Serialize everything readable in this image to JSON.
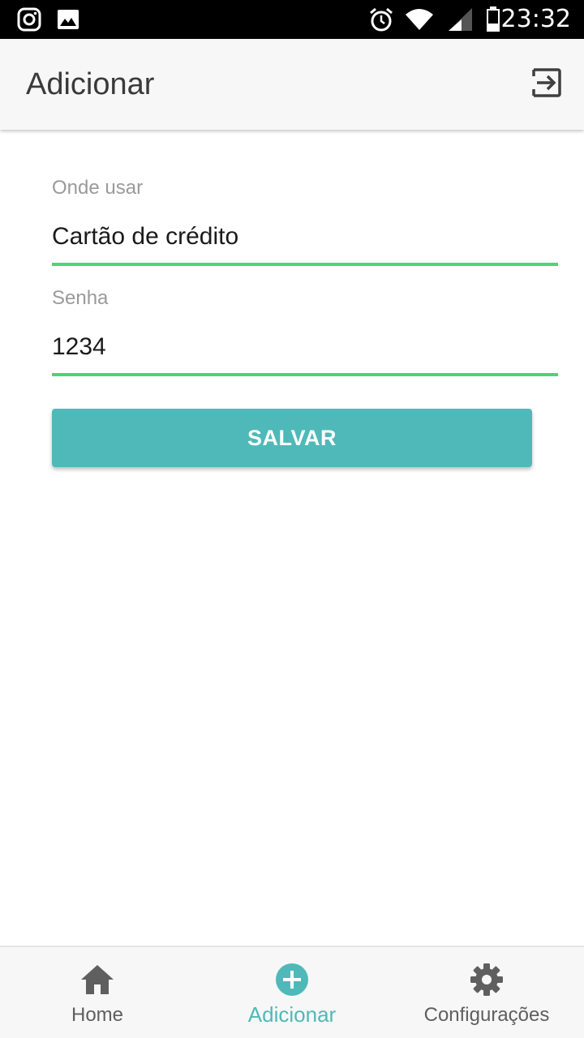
{
  "status_bar": {
    "left_icons": [
      "instagram-icon",
      "image-icon"
    ],
    "right_icons": [
      "alarm-icon",
      "wifi-icon",
      "signal-icon",
      "battery-icon"
    ],
    "time": "23:32"
  },
  "app_bar": {
    "title": "Adicionar",
    "action_icon": "logout-icon"
  },
  "form": {
    "onde_usar": {
      "label": "Onde usar",
      "value": "Cartão de crédito"
    },
    "senha": {
      "label": "Senha",
      "value": "1234"
    },
    "save_label": "SALVAR"
  },
  "bottom_nav": {
    "items": [
      {
        "label": "Home",
        "icon": "home-icon",
        "active": false
      },
      {
        "label": "Adicionar",
        "icon": "add-circle-icon",
        "active": true
      },
      {
        "label": "Configurações",
        "icon": "gear-icon",
        "active": false
      }
    ]
  },
  "colors": {
    "accent": "#4fb9b9",
    "underline": "#4cd37a",
    "status_bar": "#000000",
    "app_bar": "#f7f7f7"
  }
}
